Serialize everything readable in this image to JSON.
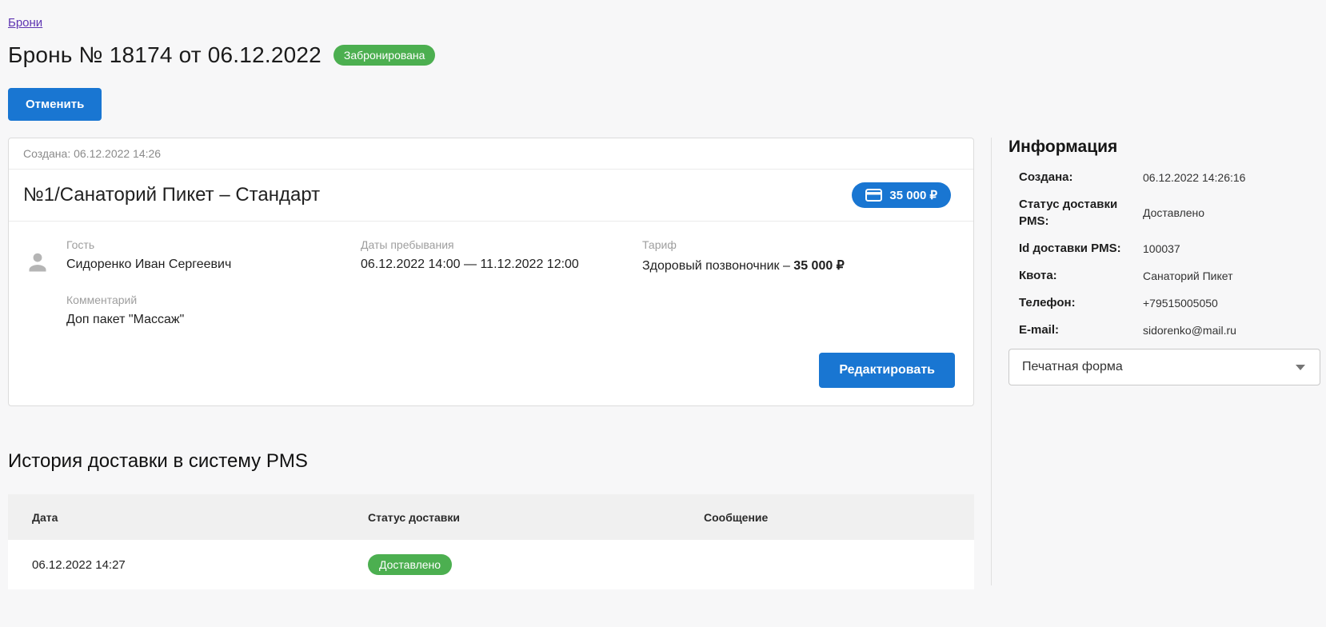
{
  "page": {
    "breadcrumb": "Брони",
    "title": "Бронь № 18174 от 06.12.2022",
    "status_badge": "Забронирована",
    "cancel_button": "Отменить"
  },
  "booking_card": {
    "created_line": "Создана: 06.12.2022 14:26",
    "room_title": "№1/Санаторий Пикет – Стандарт",
    "price_badge": "35 000 ₽",
    "guest": {
      "label": "Гость",
      "value": "Сидоренко Иван Сергеевич"
    },
    "stay_dates": {
      "label": "Даты пребывания",
      "value": "06.12.2022 14:00 — 11.12.2022 12:00"
    },
    "tariff": {
      "label": "Тариф",
      "name": "Здоровый позвоночник – ",
      "price": "35 000 ₽"
    },
    "comment": {
      "label": "Комментарий",
      "value": "Доп пакет \"Массаж\""
    },
    "edit_button": "Редактировать"
  },
  "info_panel": {
    "title": "Информация",
    "rows": [
      {
        "label": "Создана:",
        "value": "06.12.2022 14:26:16"
      },
      {
        "label": "Статус доставки PMS:",
        "value": "Доставлено"
      },
      {
        "label": "Id доставки PMS:",
        "value": "100037"
      },
      {
        "label": "Квота:",
        "value": "Санаторий Пикет"
      },
      {
        "label": "Телефон:",
        "value": "+79515005050"
      },
      {
        "label": "E-mail:",
        "value": "sidorenko@mail.ru"
      }
    ],
    "print_form_select": {
      "value": "Печатная форма"
    }
  },
  "history": {
    "title": "История доставки в систему PMS",
    "columns": [
      "Дата",
      "Статус доставки",
      "Сообщение"
    ],
    "rows": [
      {
        "date": "06.12.2022 14:27",
        "status": "Доставлено",
        "message": ""
      }
    ]
  },
  "colors": {
    "accent_blue": "#1976d2",
    "status_green": "#4caf50",
    "link_purple": "#5e35b1"
  },
  "icons": {
    "guest_avatar": "person-icon",
    "price": "credit-card-icon",
    "select": "chevron-down-icon"
  }
}
